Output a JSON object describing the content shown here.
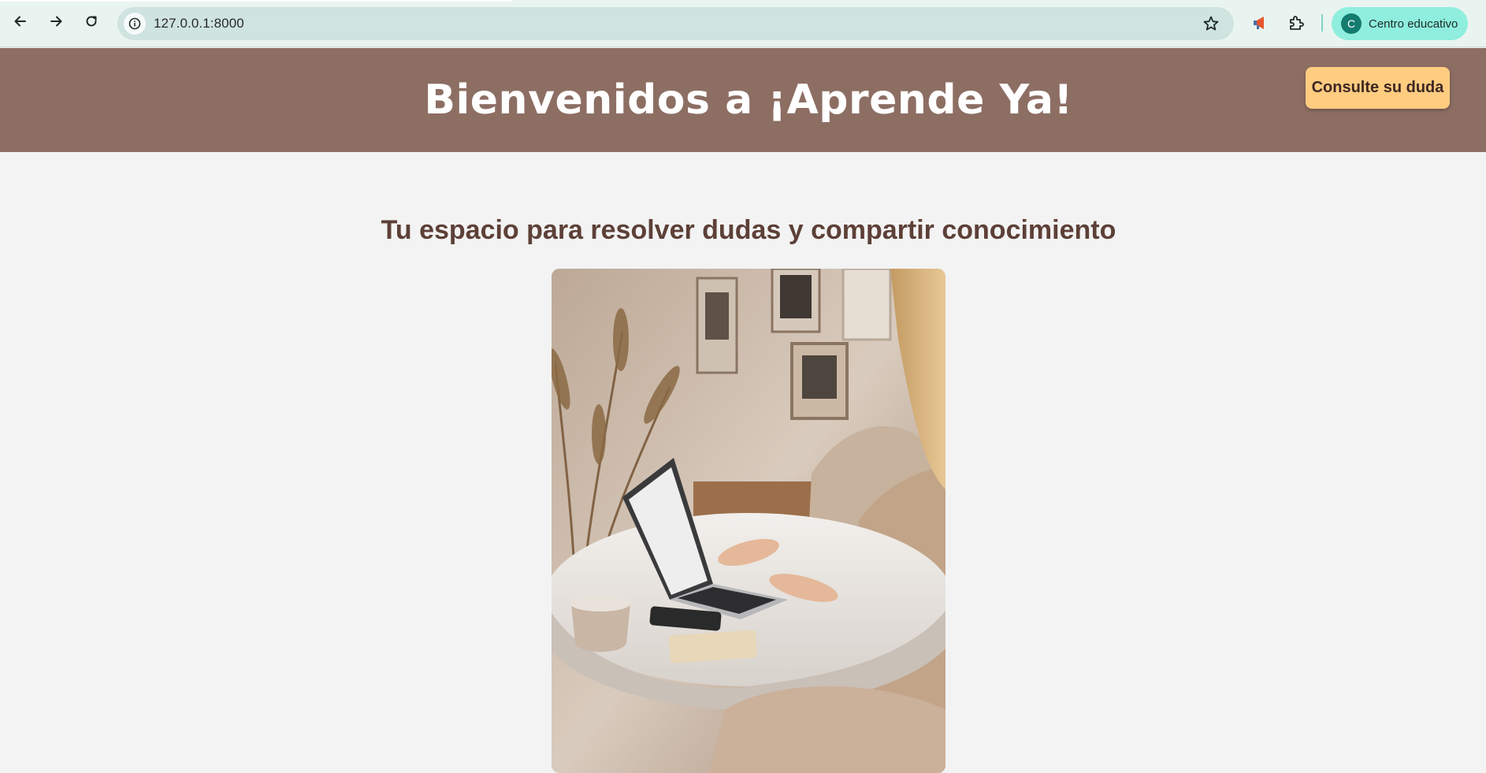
{
  "browser": {
    "url": "127.0.0.1:8000",
    "profile_initial": "C",
    "profile_name": "Centro educativo",
    "icons": [
      "back-arrow-icon",
      "forward-arrow-icon",
      "reload-icon",
      "site-info-icon",
      "bookmark-star-icon",
      "megaphone-extension-icon",
      "extensions-puzzle-icon"
    ]
  },
  "header": {
    "title": "Bienvenidos a ¡Aprende Ya!",
    "consult_button": "Consulte su duda",
    "background_color": "#8d6e63",
    "button_color": "#ffcc80"
  },
  "main": {
    "subtitle": "Tu espacio para resolver dudas y compartir conocimiento",
    "subtitle_color": "#5d4037"
  }
}
